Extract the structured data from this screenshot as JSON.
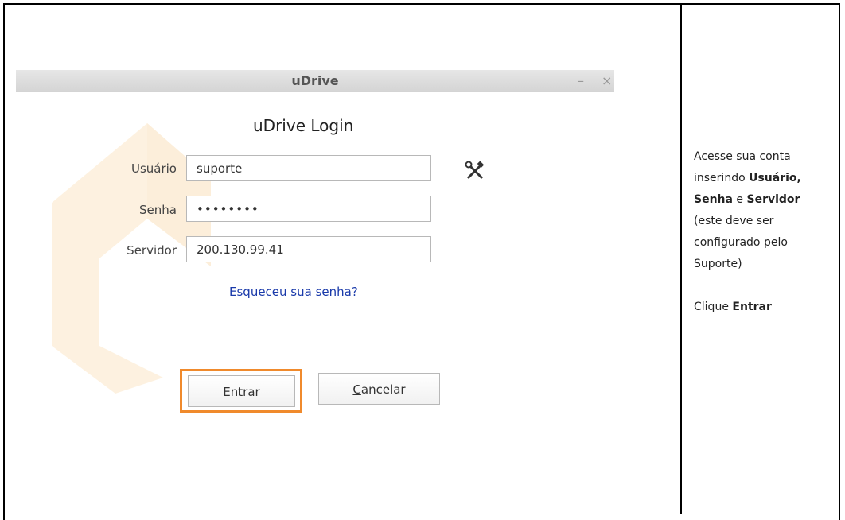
{
  "window": {
    "title": "uDrive",
    "minimize_label": "–",
    "close_label": "×"
  },
  "login": {
    "heading": "uDrive Login",
    "usuario_label": "Usuário",
    "usuario_value": "suporte",
    "senha_label": "Senha",
    "senha_value": "••••••••",
    "servidor_label": "Servidor",
    "servidor_value": "200.130.99.41",
    "forgot_link": "Esqueceu sua senha?",
    "entrar_button": "Entrar",
    "cancelar_first": "C",
    "cancelar_rest": "ancelar",
    "settings_icon": "tools-icon",
    "accent_color": "#f08a2c"
  },
  "instructions": {
    "line1": "Acesse sua conta",
    "line2_prefix": "inserindo ",
    "line2_bold": "Usuário,",
    "line3_bold1": "Senha",
    "line3_mid": " e ",
    "line3_bold2": "Servidor",
    "line4": "(este deve ser",
    "line5": "configurado pelo",
    "line6": "Suporte)",
    "line7_prefix": "Clique ",
    "line7_bold": "Entrar"
  }
}
